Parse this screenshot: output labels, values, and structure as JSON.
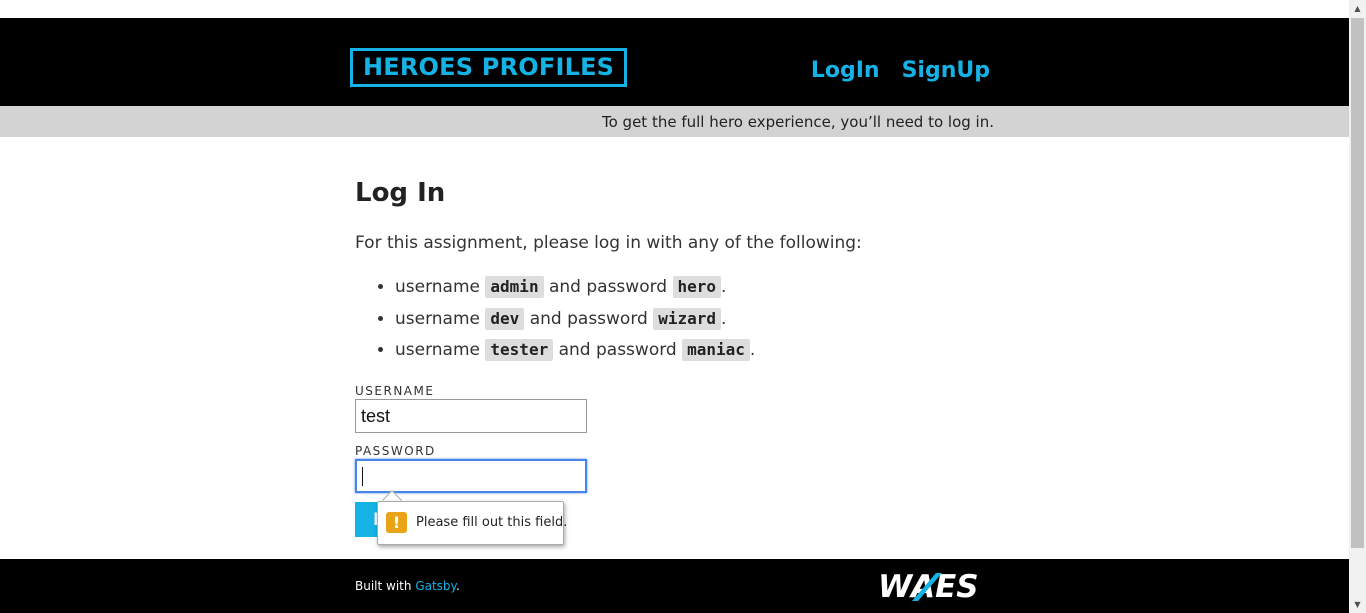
{
  "header": {
    "brand": "HEROES PROFILES",
    "nav": {
      "login": "LogIn",
      "signup": "SignUp"
    }
  },
  "notice": "To get the full hero experience, you’ll need to log in.",
  "main": {
    "title": "Log In",
    "intro": "For this assignment, please log in with any of the following:",
    "credentials": [
      {
        "prefix": "username",
        "username": "admin",
        "middle": "and password",
        "password": "hero",
        "suffix": "."
      },
      {
        "prefix": "username",
        "username": "dev",
        "middle": "and password",
        "password": "wizard",
        "suffix": "."
      },
      {
        "prefix": "username",
        "username": "tester",
        "middle": "and password",
        "password": "maniac",
        "suffix": "."
      }
    ]
  },
  "form": {
    "username_label": "USERNAME",
    "username_value": "test",
    "password_label": "PASSWORD",
    "password_value": "",
    "submit_label": "Log In"
  },
  "tooltip": {
    "message": "Please fill out this field.",
    "icon": "warning-icon"
  },
  "footer": {
    "built_prefix": "Built with ",
    "built_link": "Gatsby",
    "built_suffix": ".",
    "logo_text": "WAES"
  },
  "colors": {
    "accent": "#15b2e6",
    "header_bg": "#000000",
    "notice_bg": "#d3d3d3",
    "focus": "#4a86e8",
    "warning": "#e8a317"
  }
}
